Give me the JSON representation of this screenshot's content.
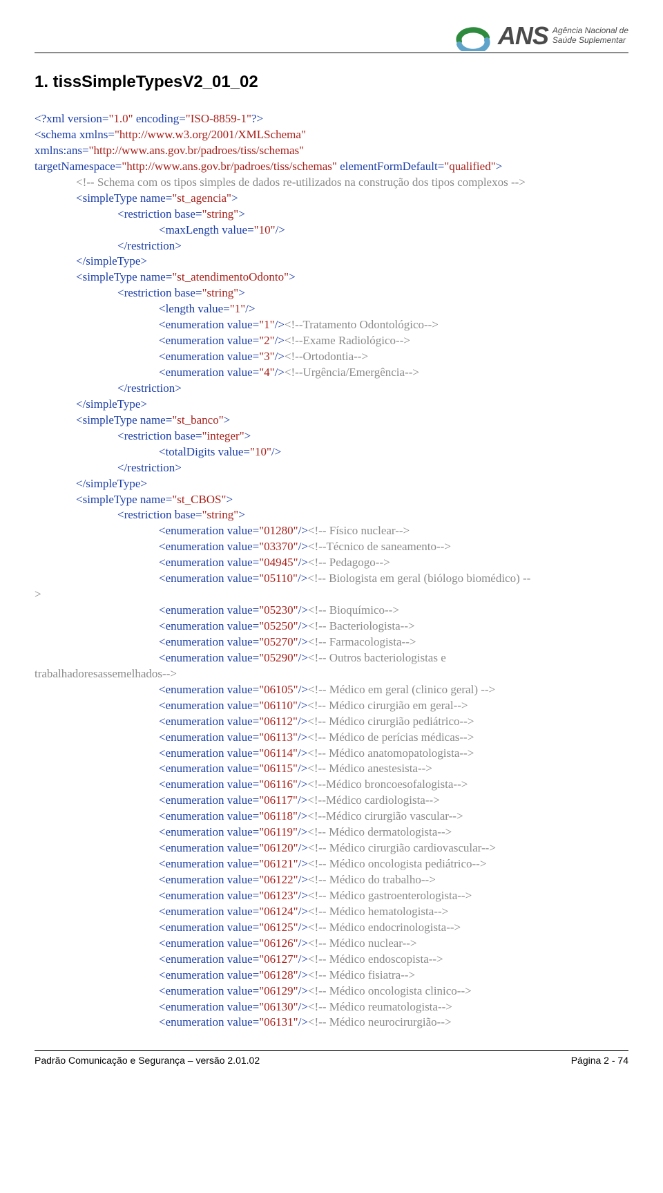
{
  "logo": {
    "acronym": "ANS",
    "line1": "Agência Nacional de",
    "line2": "Saúde Suplementar"
  },
  "title": "1. tissSimpleTypesV2_01_02",
  "xml_decl": {
    "ver": "1.0",
    "enc": "ISO-8859-1"
  },
  "schema": {
    "xmlns": "http://www.w3.org/2001/XMLSchema",
    "xmlns_ans": "http://www.ans.gov.br/padroes/tiss/schemas",
    "targetNamespace": "http://www.ans.gov.br/padroes/tiss/schemas",
    "elementFormDefault": "qualified"
  },
  "comment_top": "Schema com os tipos simples de dados re-utilizados na construção dos tipos complexos",
  "st_agencia": {
    "name": "st_agencia",
    "base": "string",
    "maxLength": "10"
  },
  "st_atOdonto": {
    "name": "st_atendimentoOdonto",
    "base": "string",
    "length": "1",
    "enums": [
      {
        "v": "1",
        "c": "Tratamento Odontológico"
      },
      {
        "v": "2",
        "c": "Exame Radiológico"
      },
      {
        "v": "3",
        "c": "Ortodontia"
      },
      {
        "v": "4",
        "c": "Urgência/Emergência"
      }
    ]
  },
  "st_banco": {
    "name": "st_banco",
    "base": "integer",
    "totalDigits": "10"
  },
  "st_cbos": {
    "name": "st_CBOS",
    "base": "string",
    "enums_a": [
      {
        "v": "01280",
        "c": " Físico nuclear"
      },
      {
        "v": "03370",
        "c": "Técnico de saneamento"
      },
      {
        "v": "04945",
        "c": " Pedagogo"
      },
      {
        "v": "05110",
        "c": " Biologista em geral (biólogo biomédico) --"
      }
    ],
    "gt": ">",
    "enums_b": [
      {
        "v": "05230",
        "c": " Bioquímico"
      },
      {
        "v": "05250",
        "c": " Bacteriologista"
      },
      {
        "v": "05270",
        "c": " Farmacologista"
      },
      {
        "v": "05290",
        "c": " Outros bacteriologistas e"
      }
    ],
    "wrap_line": "trabalhadoresassemelhados",
    "enums_c": [
      {
        "v": "06105",
        "c": " Médico em geral (clinico geral) "
      },
      {
        "v": "06110",
        "c": " Médico cirurgião em geral"
      },
      {
        "v": "06112",
        "c": " Médico cirurgião pediátrico"
      },
      {
        "v": "06113",
        "c": " Médico de perícias médicas"
      },
      {
        "v": "06114",
        "c": " Médico anatomopatologista"
      },
      {
        "v": "06115",
        "c": " Médico anestesista"
      },
      {
        "v": "06116",
        "c": "Médico broncoesofalogista"
      },
      {
        "v": "06117",
        "c": "Médico cardiologista"
      },
      {
        "v": "06118",
        "c": "Médico cirurgião vascular"
      },
      {
        "v": "06119",
        "c": " Médico dermatologista"
      },
      {
        "v": "06120",
        "c": " Médico cirurgião cardiovascular"
      },
      {
        "v": "06121",
        "c": " Médico oncologista pediátrico"
      },
      {
        "v": "06122",
        "c": " Médico do trabalho"
      },
      {
        "v": "06123",
        "c": " Médico gastroenterologista"
      },
      {
        "v": "06124",
        "c": " Médico hematologista"
      },
      {
        "v": "06125",
        "c": " Médico endocrinologista"
      },
      {
        "v": "06126",
        "c": " Médico nuclear"
      },
      {
        "v": "06127",
        "c": " Médico endoscopista"
      },
      {
        "v": "06128",
        "c": " Médico fisiatra"
      },
      {
        "v": "06129",
        "c": " Médico oncologista clinico"
      },
      {
        "v": "06130",
        "c": " Médico reumatologista"
      },
      {
        "v": "06131",
        "c": " Médico neurocirurgião"
      }
    ]
  },
  "footer": {
    "left": "Padrão Comunicação e Segurança – versão 2.01.02",
    "right": "Página 2 - 74"
  }
}
